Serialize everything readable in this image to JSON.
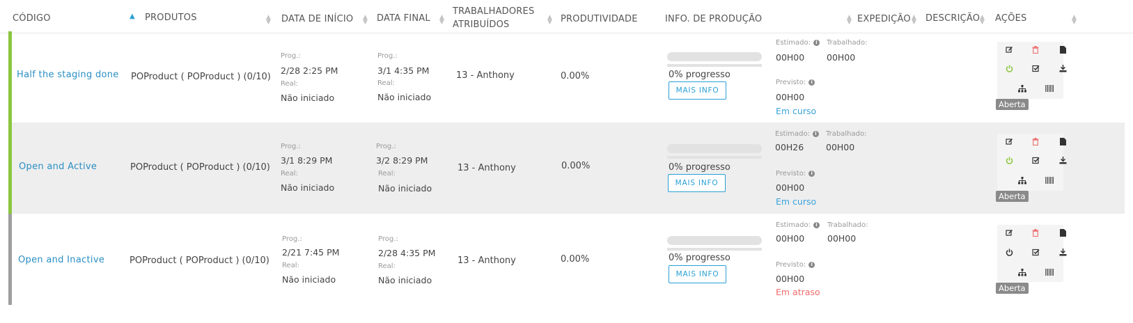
{
  "header": {
    "codigo": "CÓDIGO",
    "produtos": "PRODUTOS",
    "data_inicio": "DATA DE INÍCIO",
    "data_final": "DATA FINAL",
    "trabalhadores_1": "TRABALHADORES",
    "trabalhadores_2": "ATRIBUÍDOS",
    "produtividade": "PRODUTIVIDADE",
    "info_producao": "INFO. DE PRODUÇÃO",
    "expedicao": "EXPEDIÇÃO",
    "descricao": "DESCRIÇÃO",
    "acoes": "AÇÕES"
  },
  "labels": {
    "prog": "Prog.:",
    "real": "Real:",
    "estimado": "Estimado:",
    "trabalhado": "Trabalhado:",
    "previsto": "Previsto:",
    "mais_info": "MAIS INFO",
    "info_icon": "i"
  },
  "rows": [
    {
      "codigo": "Half the staging done",
      "produto": "POProduct ( POProduct ) (0/10)",
      "inicio_prog": "2/28   2:25 PM",
      "inicio_real": "Não iniciado",
      "final_prog": "3/1   4:35 PM",
      "final_real": "Não iniciado",
      "trabalhadores": "13 - Anthony",
      "produtividade": "0.00%",
      "progresso": "0% progresso",
      "progress_value": 0,
      "estimado": "00H00",
      "trabalhado": "00H00",
      "previsto": "00H00",
      "status": "Em curso",
      "status_color": "#3aa3dc",
      "bar_color": "#8cc63f",
      "badge": "Aberta",
      "power_color": "#8cc63f"
    },
    {
      "codigo": "Open and Active",
      "produto": "POProduct ( POProduct ) (0/10)",
      "inicio_prog": "3/1   8:29 PM",
      "inicio_real": "Não iniciado",
      "final_prog": "3/2   8:29 PM",
      "final_real": "Não iniciado",
      "trabalhadores": "13 - Anthony",
      "produtividade": "0.00%",
      "progresso": "0% progresso",
      "progress_value": 0,
      "estimado": "00H26",
      "trabalhado": "00H00",
      "previsto": "00H00",
      "status": "Em curso",
      "status_color": "#3aa3dc",
      "bar_color": "#8cc63f",
      "badge": "Aberta",
      "power_color": "#8cc63f"
    },
    {
      "codigo": "Open and Inactive",
      "produto": "POProduct ( POProduct ) (0/10)",
      "inicio_prog": "2/21   7:45 PM",
      "inicio_real": "Não iniciado",
      "final_prog": "2/28   4:35 PM",
      "final_real": "Não iniciado",
      "trabalhadores": "13 - Anthony",
      "produtividade": "0.00%",
      "progresso": "0% progresso",
      "progress_value": 0,
      "estimado": "00H00",
      "trabalhado": "00H00",
      "previsto": "00H00",
      "status": "Em atraso",
      "status_color": "#ef6b6b",
      "bar_color": "#9e9e9e",
      "badge": "Aberta",
      "power_color": "#333333"
    }
  ],
  "icons": [
    "edit-icon",
    "delete-icon",
    "document-icon",
    "power-icon",
    "checkbox-icon",
    "download-icon",
    "hierarchy-icon",
    "barcode-icon"
  ],
  "colors": {
    "accent": "#2a9fd6",
    "link": "#2a8fc4",
    "danger": "#ef6b6b",
    "active": "#8cc63f",
    "inactive": "#9e9e9e"
  }
}
